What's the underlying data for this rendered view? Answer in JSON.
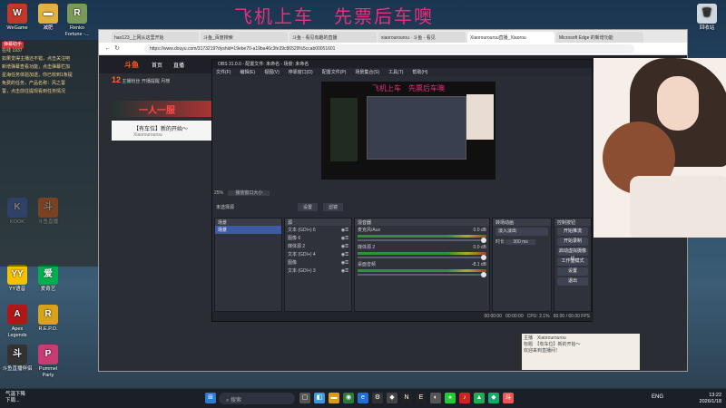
{
  "overlay_title": "飞机上车　先票后车噢",
  "desktop_left": [
    {
      "label": "WeGame",
      "icon": "wegame-icon",
      "color": "#c0392b",
      "glyph": "W"
    },
    {
      "label": "减肥",
      "icon": "folder-icon",
      "color": "#e0b040",
      "glyph": "▬"
    },
    {
      "label": "Renko Fortune -...",
      "icon": "game-icon",
      "color": "#7a9a5a",
      "glyph": "R"
    },
    {
      "label": "KOOK",
      "icon": "kook-icon",
      "color": "#3b6ad1",
      "glyph": "K"
    },
    {
      "label": "斗鱼直播",
      "icon": "douyu-icon",
      "color": "#f26b2b",
      "glyph": "斗"
    },
    {
      "label": "YY语音",
      "icon": "yy-icon",
      "color": "#f5c200",
      "glyph": "YY"
    },
    {
      "label": "爱奇艺",
      "icon": "iqiyi-icon",
      "color": "#00b050",
      "glyph": "爱"
    },
    {
      "label": "Apex Legends",
      "icon": "apex-icon",
      "color": "#b01818",
      "glyph": "A"
    },
    {
      "label": "R.E.P.O.",
      "icon": "repo-icon",
      "color": "#d9a21b",
      "glyph": "R"
    },
    {
      "label": "斗鱼直播伴侣",
      "icon": "douyu-companion-icon",
      "color": "#333",
      "glyph": "斗"
    },
    {
      "label": "Pummel Party",
      "icon": "pummel-icon",
      "color": "#c73c73",
      "glyph": "P"
    }
  ],
  "desktop_right": {
    "label": "回收站",
    "icon": "recycle-bin-icon"
  },
  "left_chat": {
    "header": "弹幕助手",
    "messages": [
      "在线 1937",
      "如果觉得主播还不错，点击关注吧",
      "新增弹幕查看功能，点击弹幕栏加",
      "星海任务体验加送，你已收到1条提",
      "免费的任务，产品名称：风之誓",
      "誓，点击前往提现看到任务情况"
    ]
  },
  "browser": {
    "tabs": [
      "hao123_上网从这里开始",
      "斗鱼_百度搜索",
      "斗鱼 - 看见有趣的直播",
      "xiaorourourou · 斗鱼 - 看见",
      "Xiaorourourou直播_Xiaorou",
      "Microsoft Edge 的新增功能"
    ],
    "active_tab": 4,
    "url": "https://www.douyu.com/3173219?dyshid=19ebe70-a19ba46c3fe39c86529%5ccab00051601"
  },
  "douyu": {
    "logo": "斗鱼",
    "nav": [
      "首页",
      "直播"
    ],
    "room_title": "【有车位】新的开始～",
    "streamer": "Xiaorourourou",
    "banner": "一人一服",
    "room_stats": [
      "12",
      "主播粉丝",
      "开播提醒",
      "月榜"
    ]
  },
  "obs": {
    "title": "OBS 31.0.0 - 配置文件: 未命名 - 场景: 未命名",
    "menu": [
      "文件(F)",
      "编辑(E)",
      "视图(V)",
      "停靠窗口(D)",
      "配置文件(P)",
      "场景集合(S)",
      "工具(T)",
      "帮助(H)"
    ],
    "preview_title": "飞机上车　先票后车噢",
    "zoom": "25%",
    "zoom_label": "播放窗口大小",
    "no_source": "未选择源",
    "props_btn": "设置",
    "filters_btn": "滤镜",
    "scenes_header": "场景",
    "scenes": [
      "场景"
    ],
    "sources_header": "源",
    "sources": [
      "文本 (GDI+) 6",
      "图像 6",
      "媒体源 2",
      "文本 (GDI+) 4",
      "图像",
      "文本 (GDI+) 3"
    ],
    "mixer_header": "混音器",
    "mixer": [
      {
        "name": "麦克风/Aux",
        "db": "0.0 dB"
      },
      {
        "name": "媒体源 2",
        "db": "0.0 dB"
      },
      {
        "name": "桌面音频",
        "db": "-8.1 dB"
      }
    ],
    "transition_header": "转场动画",
    "transition": "淡入淡出",
    "duration_label": "时长",
    "duration": "300 ms",
    "controls_header": "控制按钮",
    "controls": [
      "开始推流",
      "开始录制",
      "启动虚拟摄像机",
      "工作室模式",
      "设置",
      "退出"
    ],
    "status": [
      "00:00:00",
      "00:00:00",
      "CPU: 2.1%",
      "60.00 / 60.00 FPS"
    ]
  },
  "right_chat": {
    "lines": [
      "主播　Xiaorourourou",
      "标题　【有车位】新的开始～",
      "欢迎来到直播间！"
    ]
  },
  "taskbar": {
    "weather": "气温下降",
    "weather_sub": "下周...",
    "search": "搜索",
    "lang": "ENG",
    "time": "13:22",
    "date": "2026/1/18"
  },
  "colors": {
    "accent": "#e8307a",
    "obs_selected": "#3c5aa6",
    "douyu_orange": "#ff5a1e"
  }
}
